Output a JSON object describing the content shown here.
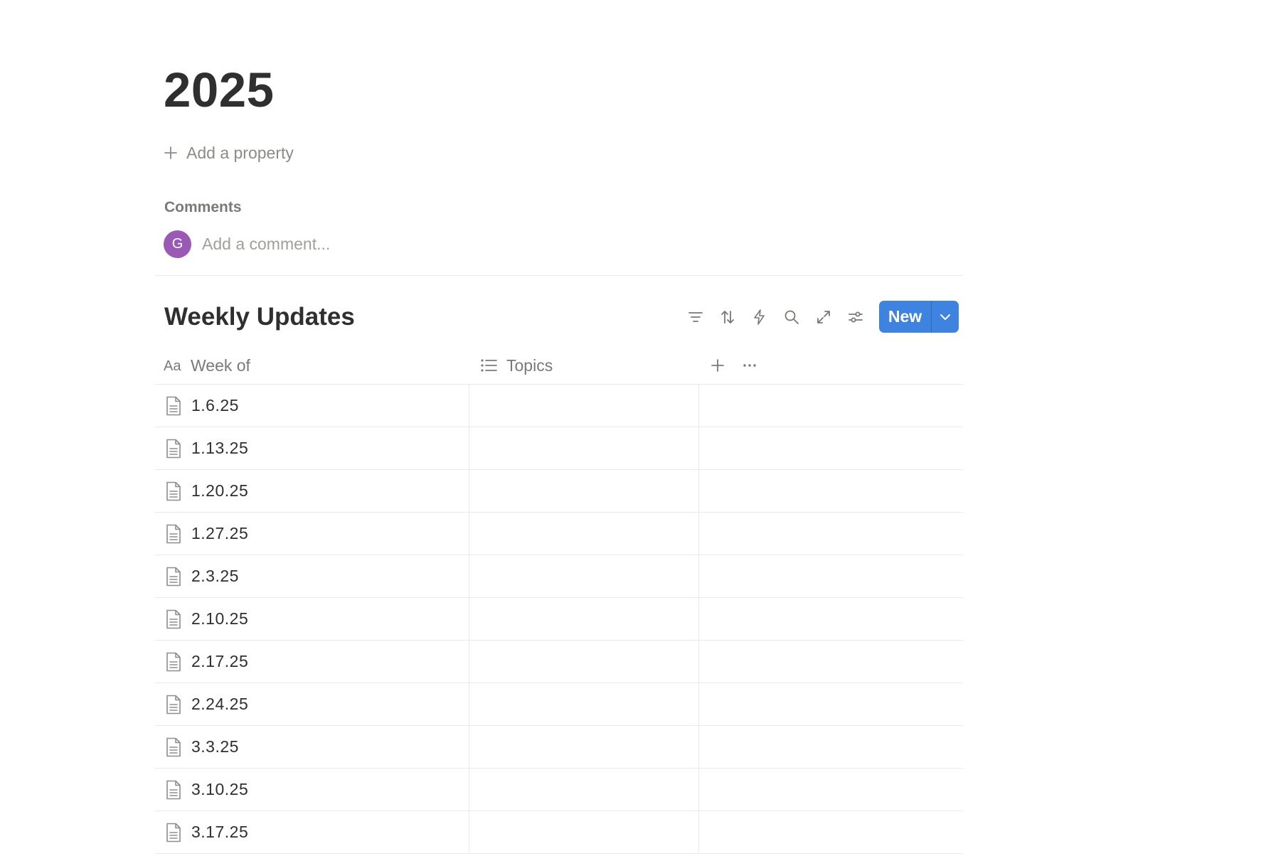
{
  "page": {
    "title": "2025",
    "add_property_label": "Add a property"
  },
  "comments": {
    "label": "Comments",
    "avatar_initial": "G",
    "avatar_color": "#9b59b6",
    "input_placeholder": "Add a comment..."
  },
  "database": {
    "title": "Weekly Updates",
    "toolbar": {
      "icons": [
        "filter-icon",
        "sort-icon",
        "automation-icon",
        "search-icon",
        "expand-icon",
        "settings-sliders-icon"
      ],
      "new_label": "New",
      "new_button_color": "#3d83df"
    },
    "columns": [
      {
        "label": "Week of",
        "icon": "text-property-icon"
      },
      {
        "label": "Topics",
        "icon": "list-property-icon"
      }
    ],
    "rows": [
      {
        "label": "1.6.25"
      },
      {
        "label": "1.13.25"
      },
      {
        "label": "1.20.25"
      },
      {
        "label": "1.27.25"
      },
      {
        "label": "2.3.25"
      },
      {
        "label": "2.10.25"
      },
      {
        "label": "2.17.25"
      },
      {
        "label": "2.24.25"
      },
      {
        "label": "3.3.25"
      },
      {
        "label": "3.10.25"
      },
      {
        "label": "3.17.25"
      }
    ]
  }
}
